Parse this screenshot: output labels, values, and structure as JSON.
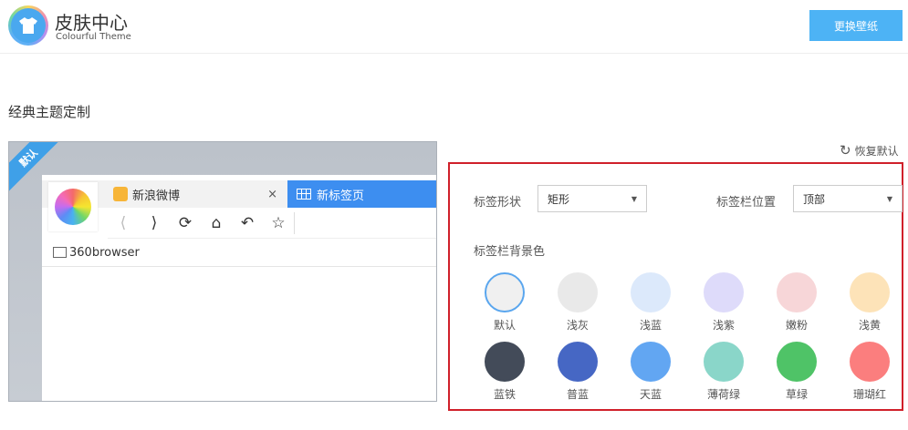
{
  "header": {
    "title": "皮肤中心",
    "subtitle": "Colourful Theme",
    "wallpaper_button": "更换壁纸"
  },
  "section_title": "经典主题定制",
  "preview": {
    "badge": "默认",
    "tabs": [
      {
        "label": "新浪微博",
        "close": "×"
      },
      {
        "label": "新标签页"
      }
    ],
    "toolbar_icons": [
      "back-icon",
      "forward-icon",
      "refresh-icon",
      "home-icon",
      "undo-icon",
      "star-icon"
    ],
    "bookmark": "360browser"
  },
  "restore_label": "恢复默认",
  "settings": {
    "tab_shape_label": "标签形状",
    "tab_shape_value": "矩形",
    "tab_position_label": "标签栏位置",
    "tab_position_value": "顶部",
    "bg_color_label": "标签栏背景色",
    "colors": [
      {
        "name": "默认",
        "hex": "#f0f0f0",
        "selected": true
      },
      {
        "name": "浅灰",
        "hex": "#e9e9e9"
      },
      {
        "name": "浅蓝",
        "hex": "#dce9fb"
      },
      {
        "name": "浅紫",
        "hex": "#dedbfa"
      },
      {
        "name": "嫩粉",
        "hex": "#f7d6d8"
      },
      {
        "name": "浅黄",
        "hex": "#fde3b8"
      },
      {
        "name": "蓝铁",
        "hex": "#434b59"
      },
      {
        "name": "普蓝",
        "hex": "#4667c4"
      },
      {
        "name": "天蓝",
        "hex": "#62a6f2"
      },
      {
        "name": "薄荷绿",
        "hex": "#8ad6c9"
      },
      {
        "name": "草绿",
        "hex": "#4fc367"
      },
      {
        "name": "珊瑚红",
        "hex": "#fb7e7e"
      }
    ]
  }
}
